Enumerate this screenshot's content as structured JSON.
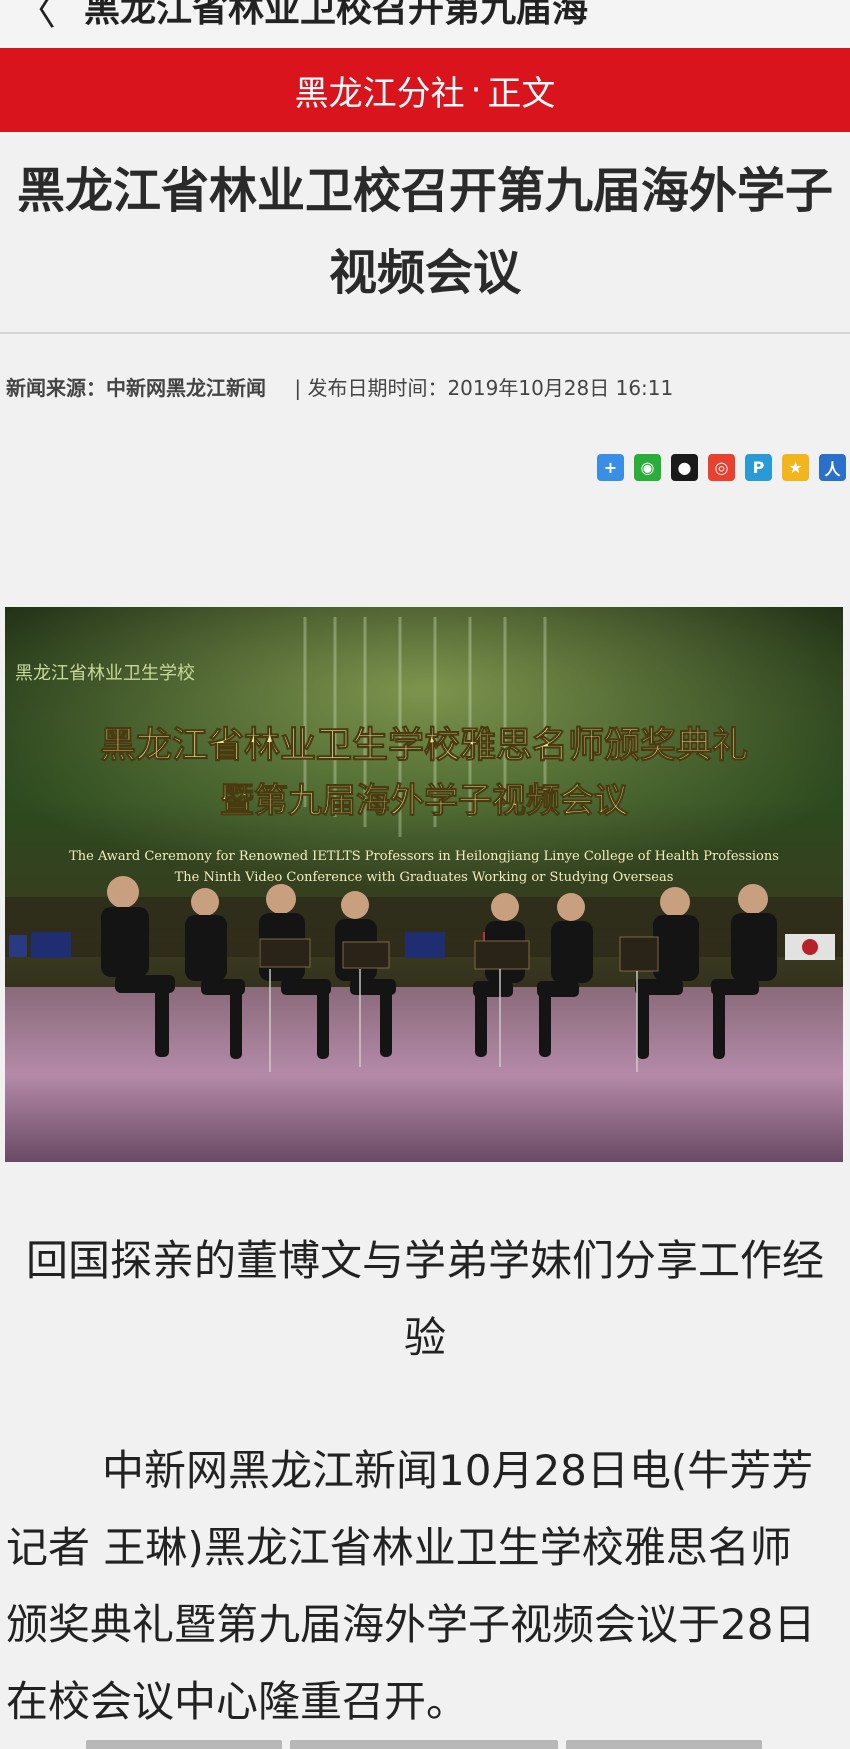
{
  "topbar": {
    "back_glyph": "〈",
    "title": "黑龙江省林业卫校召开第九届海"
  },
  "channel": {
    "name": "黑龙江分社",
    "dot": "·",
    "section": "正文"
  },
  "article": {
    "headline": "黑龙江省林业卫校召开第九届海外学子视频会议",
    "source_label": "新闻来源：中新网黑龙江新闻",
    "date_label": "| 发布日期时间：2019年10月28日 16:11",
    "share_icons": [
      {
        "name": "more-share-icon",
        "glyph": "+",
        "color": "#3a8ee6"
      },
      {
        "name": "wechat-icon",
        "glyph": "◉",
        "color": "#2aae3a"
      },
      {
        "name": "qq-icon",
        "glyph": "●",
        "color": "#1a1a1a"
      },
      {
        "name": "weibo-icon",
        "glyph": "◎",
        "color": "#e8412f"
      },
      {
        "name": "tencent-weibo-icon",
        "glyph": "P",
        "color": "#2a9ad6"
      },
      {
        "name": "qzone-icon",
        "glyph": "★",
        "color": "#f2b51c"
      },
      {
        "name": "renren-icon",
        "glyph": "人",
        "color": "#2a6fc9"
      }
    ],
    "photo": {
      "banner_line1": "黑龙江省林业卫生学校雅思名师颁奖典礼",
      "banner_line2": "暨第九届海外学子视频会议",
      "banner_en1": "The Award Ceremony for Renowned IETLTS Professors in Heilongjiang Linye College of Health Professions",
      "banner_en2": "The Ninth Video Conference with Graduates Working or Studying Overseas",
      "school_mark": "黑龙江省林业卫生学校"
    },
    "caption": "回国探亲的董博文与学弟学妹们分享工作经验",
    "body_text": "中新网黑龙江新闻10月28日电(牛芳芳 记者 王琳)黑龙江省林业卫生学校雅思名师颁奖典礼暨第九届海外学子视频会议于28日在校会议中心隆重召开。"
  }
}
